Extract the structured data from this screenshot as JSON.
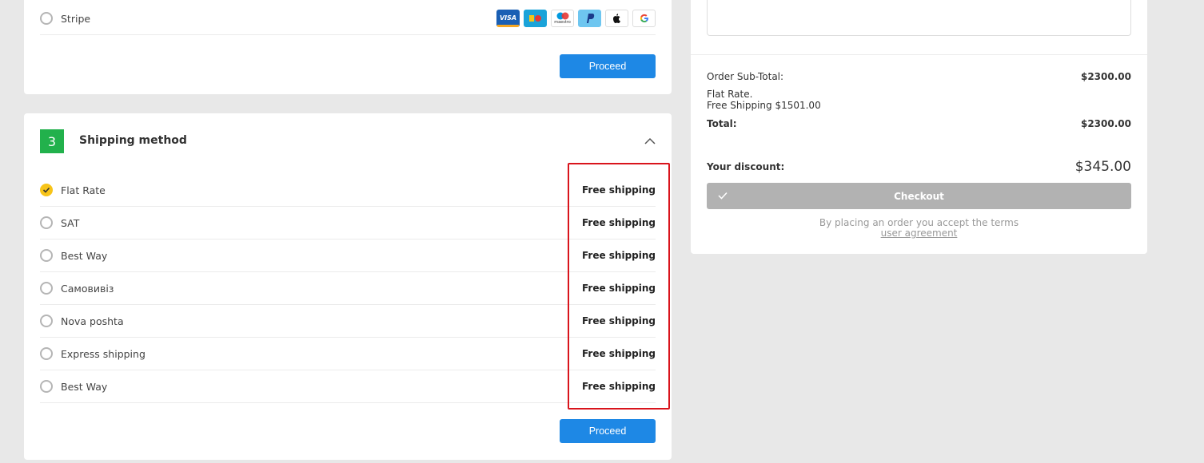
{
  "payment": {
    "stripe_label": "Stripe",
    "icons": [
      "visa-icon",
      "mastercard-icon",
      "maestro-icon",
      "paypal-icon",
      "apple-pay-icon",
      "google-pay-icon"
    ],
    "visa_text": "VISA",
    "maestro_text": "maestro",
    "proceed_label": "Proceed"
  },
  "shipping": {
    "step_number": "3",
    "title": "Shipping method",
    "methods": [
      {
        "label": "Flat Rate",
        "price": "Free shipping",
        "selected": true
      },
      {
        "label": "SAT",
        "price": "Free shipping",
        "selected": false
      },
      {
        "label": "Best Way",
        "price": "Free shipping",
        "selected": false
      },
      {
        "label": "Самовивіз",
        "price": "Free shipping",
        "selected": false
      },
      {
        "label": "Nova poshta",
        "price": "Free shipping",
        "selected": false
      },
      {
        "label": "Express shipping",
        "price": "Free shipping",
        "selected": false
      },
      {
        "label": "Best Way",
        "price": "Free shipping",
        "selected": false
      }
    ],
    "proceed_label": "Proceed"
  },
  "summary": {
    "subtotal_label": "Order Sub-Total:",
    "subtotal_value": "$2300.00",
    "shipping_line1": "Flat Rate.",
    "shipping_line2": "Free Shipping $1501.00",
    "total_label": "Total:",
    "total_value": "$2300.00",
    "discount_label": "Your discount:",
    "discount_value": "$345.00",
    "checkout_label": "Checkout",
    "terms_text": "By placing an order you accept the terms",
    "terms_link": "user agreement"
  },
  "colors": {
    "accent": "#1e88e5",
    "step_badge": "#22b14c",
    "selected_radio": "#f7c419",
    "highlight": "#d9141c",
    "checkout_disabled": "#b2b2b2"
  }
}
